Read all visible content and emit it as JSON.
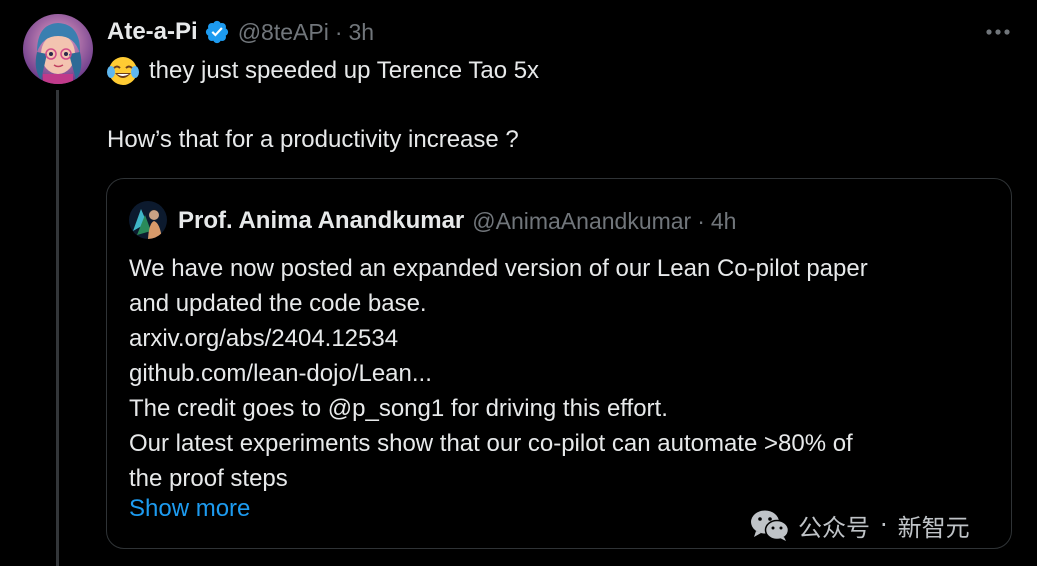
{
  "tweet": {
    "display_name": "Ate-a-Pi",
    "handle": "@8teAPi",
    "separator": "·",
    "time": "3h",
    "verified_icon": "verified-badge-icon",
    "more_icon": "more-options-icon",
    "line1": "they just speeded up Terence Tao 5x",
    "line1_emoji": "tears-of-joy-emoji",
    "line2": "How’s that for a productivity increase ?"
  },
  "quote": {
    "display_name": "Prof. Anima Anandkumar",
    "handle": "@AnimaAnandkumar",
    "separator": "·",
    "time": "4h",
    "lines": [
      "We have now posted an expanded version of our Lean Co-pilot paper",
      "and updated the code base.",
      "arxiv.org/abs/2404.12534",
      "github.com/lean-dojo/Lean...",
      "The credit goes to @p_song1 for driving this effort.",
      "Our latest experiments show that our co-pilot can automate >80% of",
      "the proof steps"
    ],
    "show_more": "Show more"
  },
  "watermark": {
    "icon": "wechat-icon",
    "account_type": "公众号",
    "separator": "·",
    "name": "新智元"
  },
  "colors": {
    "background": "#000000",
    "text_primary": "#e7e9ea",
    "text_secondary": "#71767b",
    "link": "#1d9bf0",
    "border": "#2f3336",
    "verified": "#1d9bf0"
  }
}
